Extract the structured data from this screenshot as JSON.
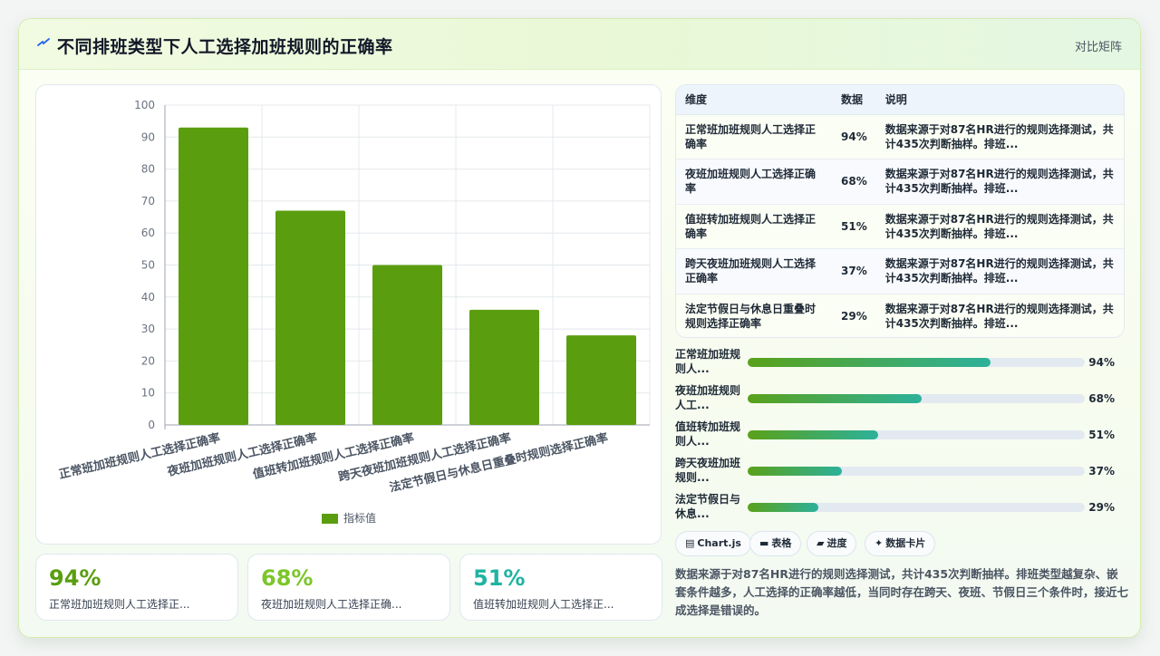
{
  "header": {
    "title": "不同排班类型下人工选择加班规则的正确率",
    "tag": "对比矩阵",
    "logo_icon": "lightning-icon"
  },
  "chart_data": {
    "type": "bar",
    "categories": [
      "正常班加班规则人工选择正确率",
      "夜班加班规则人工选择正确率",
      "值班转加班规则人工选择正确率",
      "跨天夜班加班规则人工选择正确率",
      "法定节假日与休息日重叠时规则选择正确率"
    ],
    "series": [
      {
        "name": "指标值",
        "values": [
          93,
          67,
          50,
          36,
          28
        ],
        "color": "#5a9e0f"
      }
    ],
    "ylim": [
      0,
      100
    ],
    "yticks": [
      0,
      10,
      20,
      30,
      40,
      50,
      60,
      70,
      80,
      90,
      100
    ],
    "grid": true,
    "legend": "bottom"
  },
  "stats": [
    {
      "value": "94%",
      "label": "正常班加班规则人工选择正...",
      "color": "#5a9e0f"
    },
    {
      "value": "68%",
      "label": "夜班加班规则人工选择正确...",
      "color": "#7cc62a"
    },
    {
      "value": "51%",
      "label": "值班转加班规则人工选择正...",
      "color": "#1fb3a2"
    }
  ],
  "table": {
    "headers": [
      "维度",
      "数据",
      "说明"
    ],
    "rows": [
      {
        "dim": "正常班加班规则人工选择正确率",
        "val": "94%",
        "desc": "数据来源于对87名HR进行的规则选择测试，共计435次判断抽样。排班..."
      },
      {
        "dim": "夜班加班规则人工选择正确率",
        "val": "68%",
        "desc": "数据来源于对87名HR进行的规则选择测试，共计435次判断抽样。排班..."
      },
      {
        "dim": "值班转加班规则人工选择正确率",
        "val": "51%",
        "desc": "数据来源于对87名HR进行的规则选择测试，共计435次判断抽样。排班..."
      },
      {
        "dim": "跨天夜班加班规则人工选择正确率",
        "val": "37%",
        "desc": "数据来源于对87名HR进行的规则选择测试，共计435次判断抽样。排班..."
      },
      {
        "dim": "法定节假日与休息日重叠时规则选择正确率",
        "val": "29%",
        "desc": "数据来源于对87名HR进行的规则选择测试，共计435次判断抽样。排班..."
      }
    ]
  },
  "progress": [
    {
      "label": "正常班加班规则人...",
      "value": "94%",
      "fraction": 0.72
    },
    {
      "label": "夜班加班规则人工...",
      "value": "68%",
      "fraction": 0.516
    },
    {
      "label": "值班转加班规则人...",
      "value": "51%",
      "fraction": 0.387
    },
    {
      "label": "跨天夜班加班规则...",
      "value": "37%",
      "fraction": 0.28
    },
    {
      "label": "法定节假日与休息...",
      "value": "29%",
      "fraction": 0.21
    }
  ],
  "chips": [
    {
      "label": "Chart.js",
      "icon": "chart-icon",
      "glyph": "▤"
    },
    {
      "label": "表格",
      "icon": "table-icon",
      "glyph": "▬"
    },
    {
      "label": "进度",
      "icon": "progress-icon",
      "glyph": "▰"
    },
    {
      "label": "数据卡片",
      "icon": "sparkle-icon",
      "glyph": "✦"
    }
  ],
  "note": "数据来源于对87名HR进行的规则选择测试，共计435次判断抽样。排班类型越复杂、嵌套条件越多，人工选择的正确率越低，当同时存在跨天、夜班、节假日三个条件时，接近七成选择是错误的。"
}
